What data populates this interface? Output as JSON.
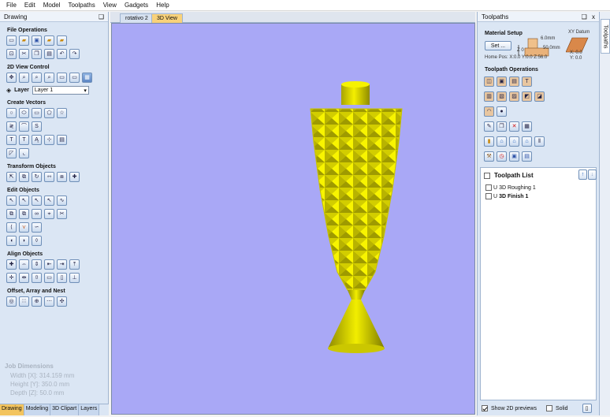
{
  "menu": [
    "File",
    "Edit",
    "Model",
    "Toolpaths",
    "View",
    "Gadgets",
    "Help"
  ],
  "left_panel": {
    "title": "Drawing",
    "pin": "❑",
    "sections": {
      "file_ops": "File Operations",
      "view_ctrl": "2D View Control",
      "create_vec": "Create Vectors",
      "transform": "Transform Objects",
      "edit": "Edit Objects",
      "align": "Align Objects",
      "offset": "Offset, Array and Nest"
    },
    "layer_label": "Layer",
    "layer_value": "Layer 1",
    "job": {
      "title": "Job Dimensions",
      "width": "Width  [X]: 314.159 mm",
      "height": "Height [Y]: 350.0 mm",
      "depth": "Depth  [Z]: 50.0 mm"
    },
    "tabs": [
      "Drawing",
      "Modeling",
      "3D Clipart",
      "Layers"
    ]
  },
  "center": {
    "tabs": [
      "rotativo 2",
      "3D View"
    ],
    "background": "#a9a8f6",
    "model_color": "#f2f000"
  },
  "right_panel": {
    "title": "Toolpaths",
    "pin": "❑",
    "close": "x",
    "side_tab": "Toolpaths",
    "material_setup": "Material Setup",
    "set_button": "Set ...",
    "dim1": "6.0mm",
    "dim2": "50.0mm",
    "z0": "Z 0",
    "home_pos": "Home Pos:  X:0.0 Y:0.0 Z:56.0",
    "xy_datum": "XY Datum",
    "datum_x": "X: 0.0",
    "datum_y": "Y: 0.0",
    "toolpath_ops": "Toolpath Operations",
    "toolpath_list": "Toolpath List",
    "items": [
      "3D Roughing 1",
      "3D Finish 1"
    ],
    "show_2d": "Show 2D previews",
    "solid": "Solid"
  }
}
